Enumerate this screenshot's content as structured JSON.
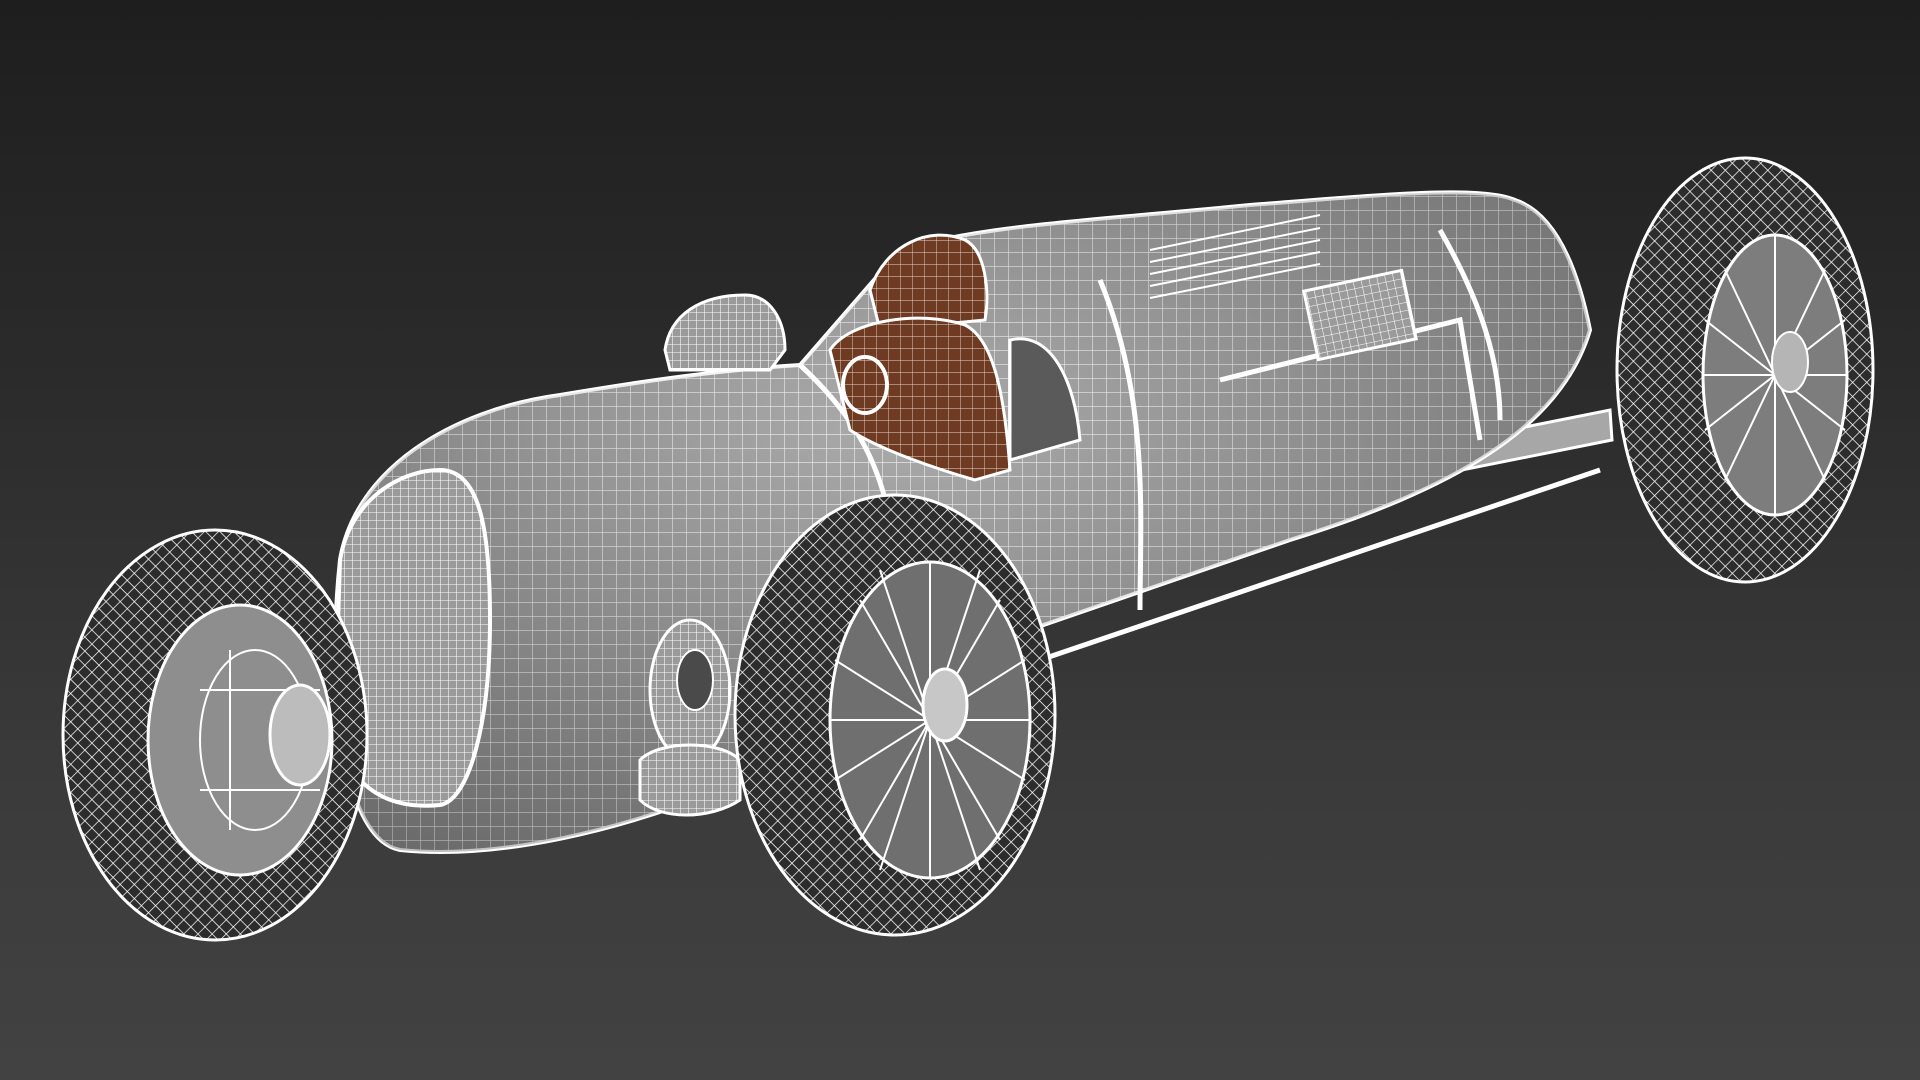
{
  "viewport": {
    "background_top": "#1e1e1e",
    "background_bottom": "#424242",
    "wire_color": "#ffffff",
    "surface_color": "#8e8e8e",
    "seat_color": "#6e3a22"
  },
  "model": {
    "subject": "car-wireframe-render",
    "render_mode": "shaded-with-wireframe"
  }
}
